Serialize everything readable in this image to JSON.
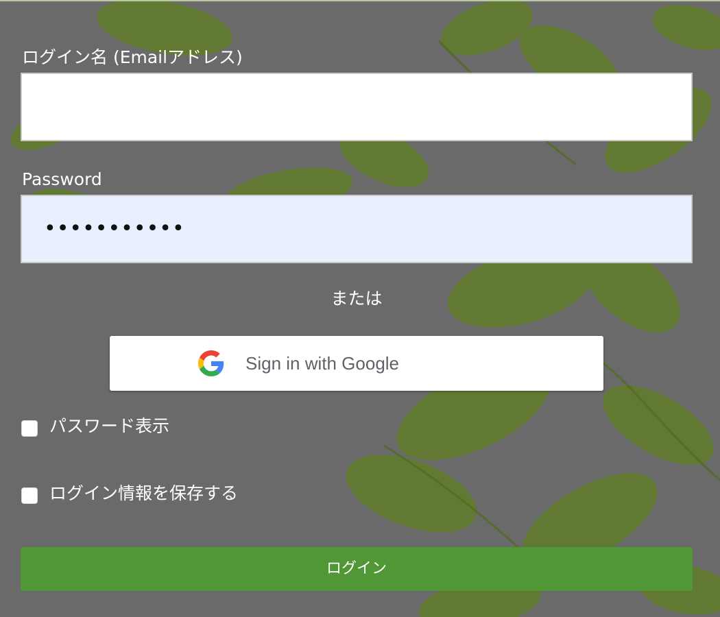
{
  "login_name": {
    "label": "ログイン名 (Emailアドレス)",
    "value": ""
  },
  "password": {
    "label": "Password",
    "value_masked": "•••••••••••"
  },
  "separator": "または",
  "google": {
    "label": "Sign in with Google",
    "icon": "google-g-icon"
  },
  "show_password": {
    "label": "パスワード表示",
    "checked": false
  },
  "remember": {
    "label": "ログイン情報を保存する",
    "checked": false
  },
  "submit_label": "ログイン",
  "colors": {
    "primary_button": "#529735",
    "overlay": "#6a6a6a",
    "password_fill": "#e8f0fe",
    "leaf": "#6f8f2a"
  }
}
